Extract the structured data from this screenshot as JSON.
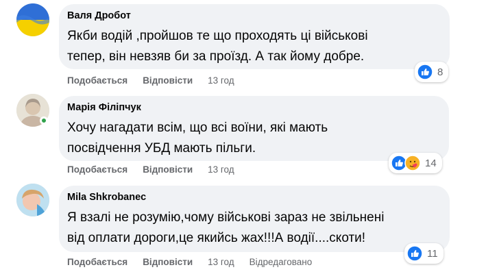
{
  "comments": [
    {
      "author": "Валя Дробот",
      "text": "Якби водій ,пройшов те що проходять ці військові\nтепер, він невзяв би за проїзд. А так йому добре.",
      "reaction_count": "8",
      "like_label": "Подобається",
      "reply_label": "Відповісти",
      "time": "13 год"
    },
    {
      "author": "Марія Філіпчук",
      "text": "Хочу нагадати всім, що всі воїни, які мають\nпосвідчення УБД мають пільги.",
      "reaction_count": "14",
      "like_label": "Подобається",
      "reply_label": "Відповісти",
      "time": "13 год"
    },
    {
      "author": "Mila Shkrobanec",
      "text": "Я взалі не розумію,чому військові зараз не звільнені\nвід оплати дороги,це якийсь жах!!!А водії....скоти!",
      "reaction_count": "11",
      "like_label": "Подобається",
      "reply_label": "Відповісти",
      "time": "13 год",
      "edited_label": "Відредаговано"
    }
  ],
  "colors": {
    "bubble": "#f0f2f5",
    "secondary_text": "#65676b",
    "like_blue": "#1877f2",
    "online_green": "#31a24c"
  }
}
